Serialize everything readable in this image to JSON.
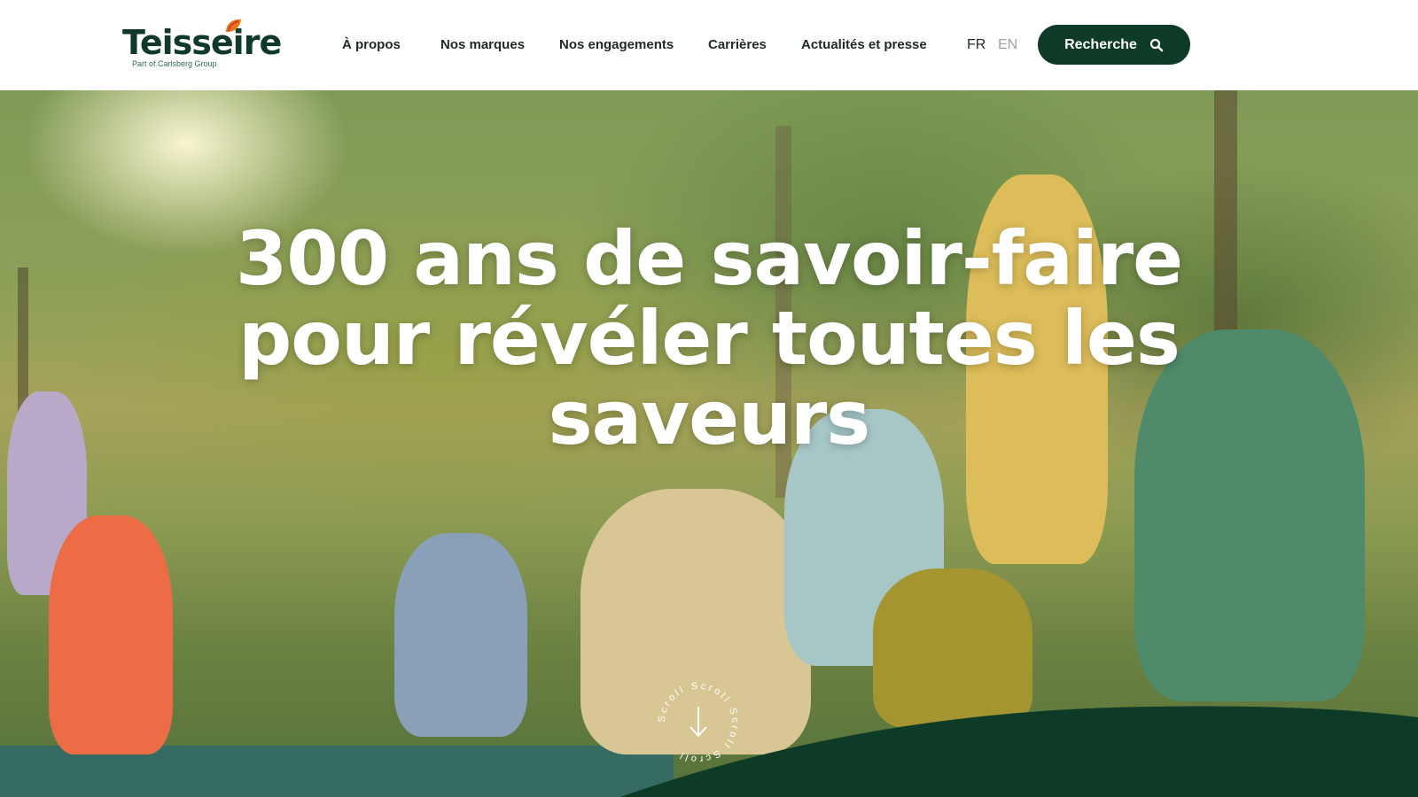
{
  "brand": {
    "name": "Teisseire",
    "tagline": "Part of Carlsberg Group",
    "colors": {
      "primary": "#0e3b28",
      "accent_orange": "#e8751a",
      "accent_red": "#d63b2f"
    }
  },
  "nav": {
    "items": [
      {
        "label": "À propos"
      },
      {
        "label": "Nos marques"
      },
      {
        "label": "Nos engagements"
      },
      {
        "label": "Carrières"
      },
      {
        "label": "Actualités et presse"
      }
    ],
    "languages": [
      {
        "code": "FR",
        "active": true
      },
      {
        "code": "EN",
        "active": false
      }
    ],
    "search_label": "Recherche",
    "search_icon": "search-icon"
  },
  "hero": {
    "headline_lines": [
      "300 ans de savoir-faire",
      "pour révéler toutes les",
      "saveurs"
    ],
    "scroll_text": "Scroll Scroll Scroll Scroll",
    "scroll_icon": "arrow-down-icon"
  }
}
